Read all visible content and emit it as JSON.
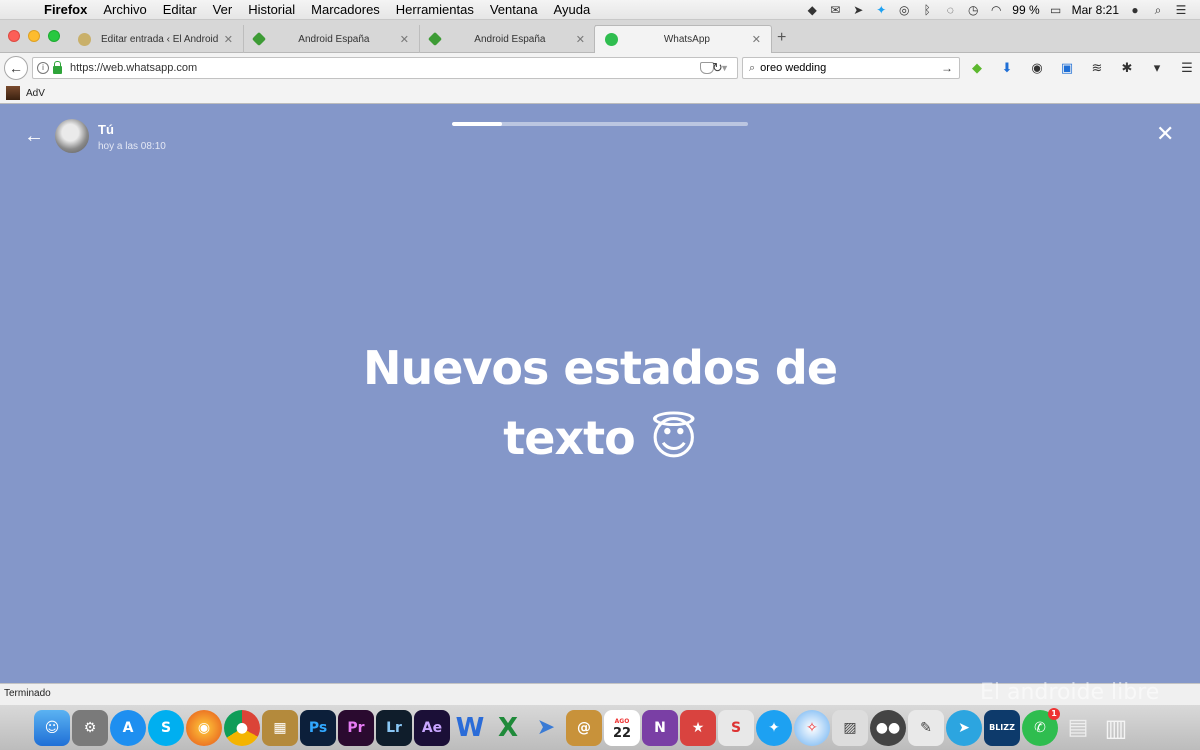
{
  "menubar": {
    "app": "Firefox",
    "items": [
      "Archivo",
      "Editar",
      "Ver",
      "Historial",
      "Marcadores",
      "Herramientas",
      "Ventana",
      "Ayuda"
    ],
    "battery": "99 %",
    "clock": "Mar 8:21"
  },
  "tabs": [
    {
      "label": "Editar entrada ‹ El Androide L",
      "favicon": "wordpress-icon"
    },
    {
      "label": "Android España",
      "favicon": "android-espana-icon"
    },
    {
      "label": "Android España",
      "favicon": "android-espana-icon"
    },
    {
      "label": "WhatsApp",
      "favicon": "whatsapp-icon",
      "active": true
    }
  ],
  "navbar": {
    "url": "https://web.whatsapp.com",
    "search_value": "oreo wedding"
  },
  "bookmarks": {
    "items": [
      {
        "label": "AdV"
      }
    ]
  },
  "status_viewer": {
    "user_name": "Tú",
    "timestamp": "hoy a las 08:10",
    "progress_fraction": 0.17,
    "text_line1": "Nuevos estados de",
    "text_line2": "texto 😇",
    "background_color": "#8497c9"
  },
  "statusbar": {
    "text": "Terminado"
  },
  "watermark": "El androide libre",
  "dock": {
    "badge_whatsapp": "1",
    "calendar_day": "22",
    "calendar_month": "AGO"
  }
}
